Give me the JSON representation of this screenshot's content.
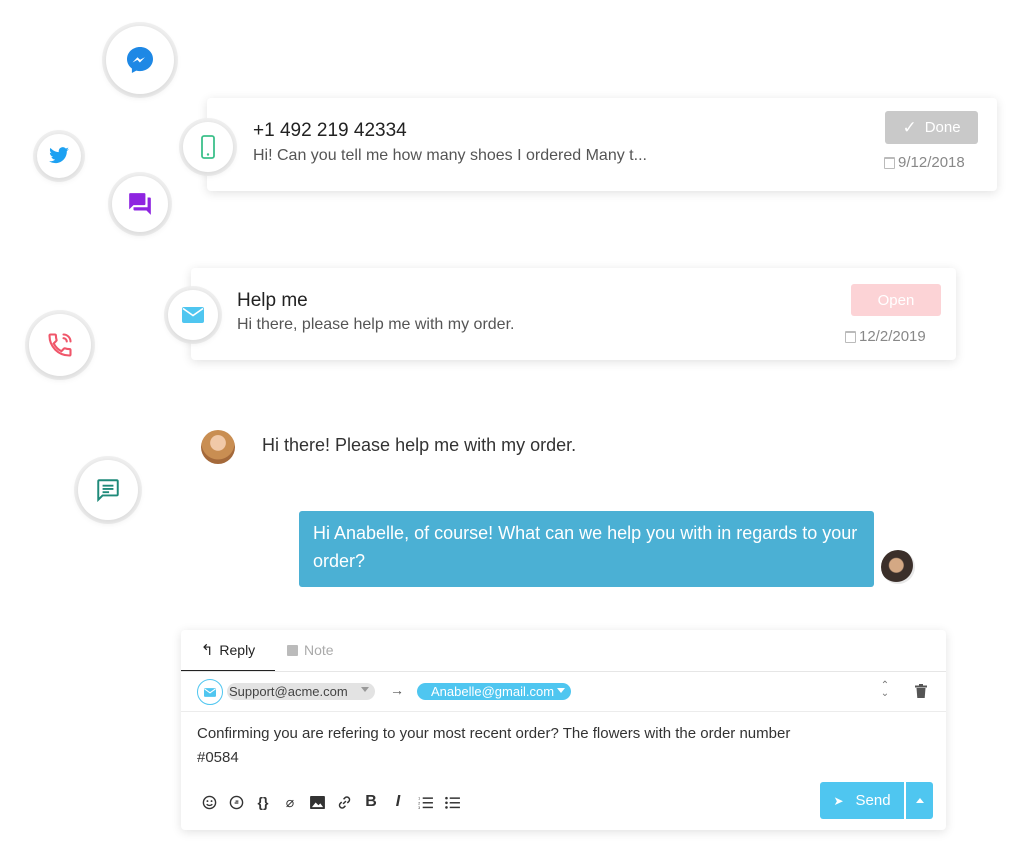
{
  "channels": [
    "messenger-icon",
    "twitter-icon",
    "chat-icon",
    "phone-icon",
    "sms-icon"
  ],
  "conversations": [
    {
      "title": "+1 492 219 42334",
      "preview": "Hi! Can you tell me how many shoes I ordered Many t...",
      "status": "Done",
      "date": "9/12/2018",
      "channel_icon": "mobile-icon"
    },
    {
      "title": "Help me",
      "preview": "Hi there, please help me with my order.",
      "status": "Open",
      "date": "12/2/2019",
      "channel_icon": "email-icon"
    }
  ],
  "chat": {
    "customer_message": "Hi there! Please help me with my order.",
    "agent_message": "Hi Anabelle, of course! What can we help you with in regards to your order?"
  },
  "composer": {
    "tab_reply": "Reply",
    "tab_note": "Note",
    "from": "Support@acme.com",
    "to": "Anabelle@gmail.com",
    "body": "Confirming you are refering to your most recent order? The flowers with the order number #0584",
    "send_label": "Send"
  },
  "colors": {
    "accent": "#4fc6f0",
    "bubble": "#4bb0d4",
    "done_badge": "#c9c9c9",
    "open_badge": "#fcd3d6",
    "messenger": "#1e88e5",
    "twitter": "#1da1f2",
    "chat": "#8e24e0",
    "phone": "#f0566a",
    "sms": "#1f8a7a",
    "mobile": "#3cc08a"
  }
}
